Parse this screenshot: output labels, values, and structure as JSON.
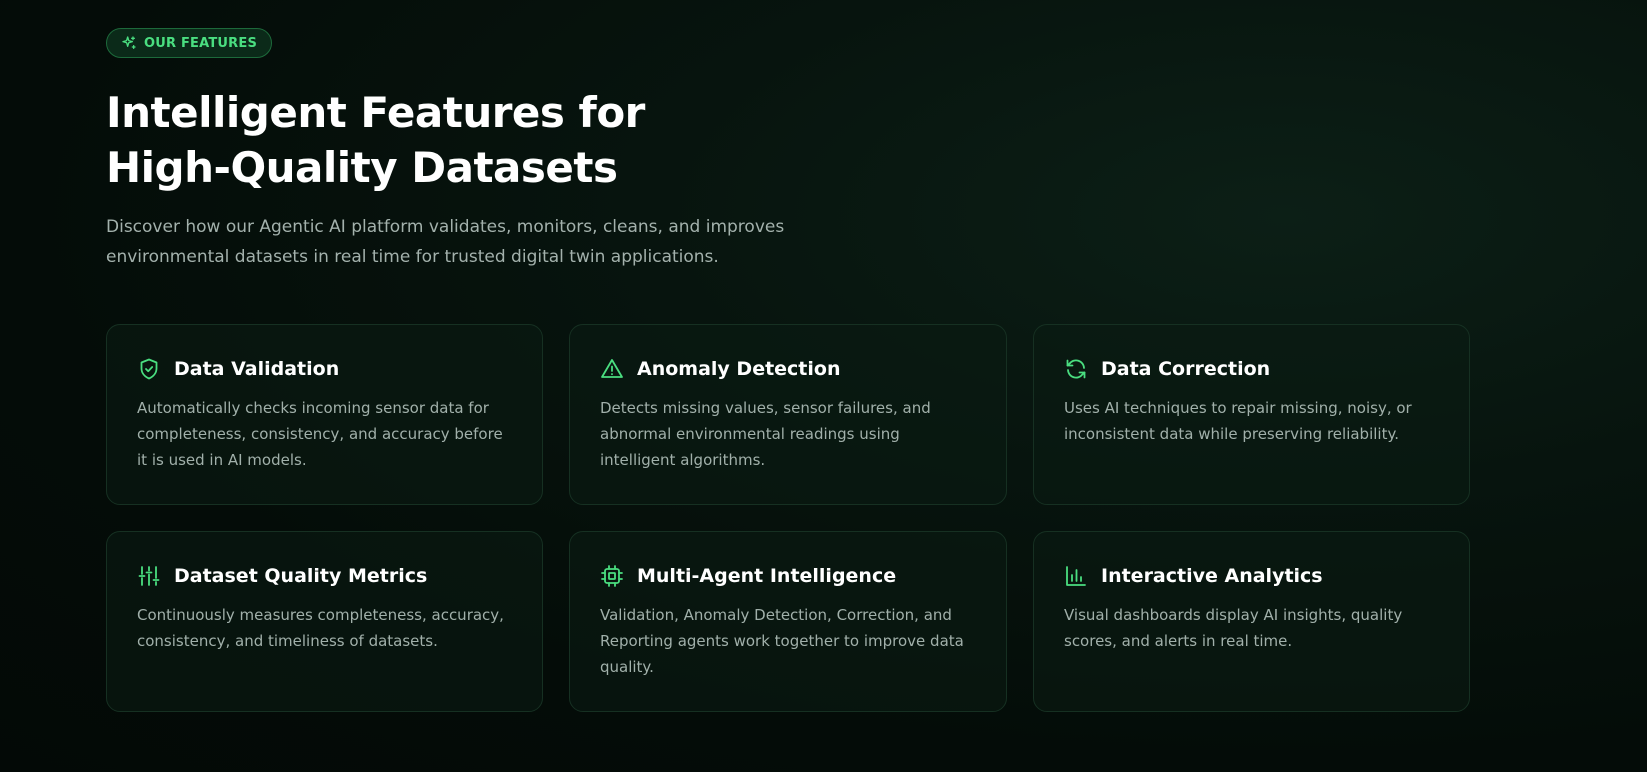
{
  "badge": {
    "label": "OUR FEATURES",
    "icon": "sparkles-icon"
  },
  "heading": {
    "line1": "Intelligent Features for",
    "line2": "High-Quality Datasets"
  },
  "subtitle": "Discover how our Agentic AI platform validates, monitors, cleans, and improves environmental datasets in real time for trusted digital twin applications.",
  "colors": {
    "accent": "#4ade80",
    "background": "#050d09",
    "card_border": "#163022"
  },
  "features": [
    {
      "icon": "shield-check-icon",
      "title": "Data Validation",
      "description": "Automatically checks incoming sensor data for completeness, consistency, and accuracy before it is used in AI models."
    },
    {
      "icon": "alert-triangle-icon",
      "title": "Anomaly Detection",
      "description": "Detects missing values, sensor failures, and abnormal environmental readings using intelligent algorithms."
    },
    {
      "icon": "refresh-icon",
      "title": "Data Correction",
      "description": "Uses AI techniques to repair missing, noisy, or inconsistent data while preserving reliability."
    },
    {
      "icon": "sliders-icon",
      "title": "Dataset Quality Metrics",
      "description": "Continuously measures completeness, accuracy, consistency, and timeliness of datasets."
    },
    {
      "icon": "cpu-chip-icon",
      "title": "Multi-Agent Intelligence",
      "description": "Validation, Anomaly Detection, Correction, and Reporting agents work together to improve data quality."
    },
    {
      "icon": "bar-chart-icon",
      "title": "Interactive Analytics",
      "description": "Visual dashboards display AI insights, quality scores, and alerts in real time."
    }
  ]
}
